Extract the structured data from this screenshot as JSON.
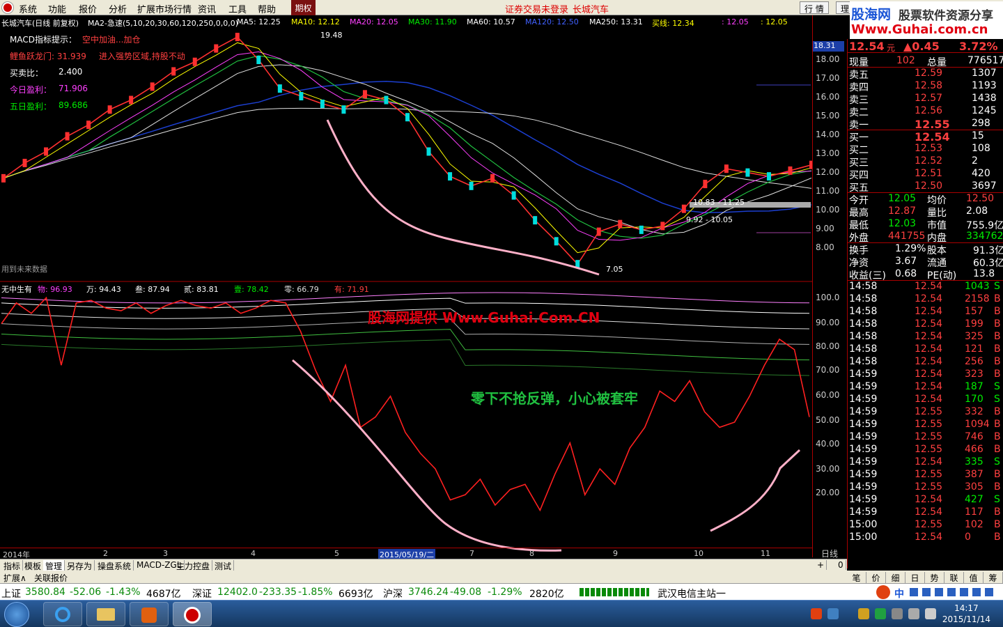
{
  "menu": {
    "items": [
      "系统",
      "功能",
      "报价",
      "分析",
      "扩展市场行情",
      "资讯",
      "工具",
      "帮助"
    ],
    "qiquan": "期权",
    "notice1": "证券交易未登录",
    "notice2": "长城汽车",
    "btn_hangqing": "行 情",
    "btn_li": "理"
  },
  "brand": {
    "line1": "股海网",
    "line2": "股票软件资源分享",
    "line3": "Www.Guhai.com.cn"
  },
  "indicator1": {
    "stock": "长城汽车(日线 前复权)",
    "formula": "MA2-急速(5,10,20,30,60,120,250,0,0,0)",
    "ma5": "MA5: 12.25",
    "ma10": "MA10: 12.12",
    "ma20": "MA20: 12.05",
    "ma30": "MA30: 11.90",
    "ma60": "MA60: 10.57",
    "ma120": "MA120: 12.50",
    "ma250": "MA250: 13.31",
    "buyline": "买线: 12.34",
    "v1": ": 12.05",
    "v2": ": 12.05"
  },
  "tips": {
    "macd": "MACD指标提示：",
    "macd_val": "空中加油...加仓",
    "liyu": "鲤鱼跃龙门: 31.939",
    "liyu_val": "进入强势区域,持股不动",
    "maimai": "买卖比：",
    "maimai_val": "2.400",
    "jinri": "今日盈利：",
    "jinri_val": "71.906",
    "wuri": "五日盈利：",
    "wuri_val": "89.686",
    "future": "用到未来数据"
  },
  "labels": {
    "high": "19.48",
    "low": "7.05",
    "r1": "10.83 - 11.25",
    "r2": "9.92 - 10.05"
  },
  "indicator2": {
    "name": "无中生有",
    "wu": "物: 96.93",
    "wan": "万: 94.43",
    "san": "叁: 87.94",
    "er": "贰: 83.81",
    "yi": "壹: 78.42",
    "ling": "零: 66.79",
    "you": "有: 71.91"
  },
  "watermark": "股海网提供 Www.Guhai.Com.CN",
  "warning": "零下不抢反弹，小心被套牢",
  "price_axis": [
    "18.00",
    "17.00",
    "16.00",
    "15.00",
    "14.00",
    "13.00",
    "12.00",
    "11.00",
    "10.00",
    "9.00",
    "8.00"
  ],
  "cur_price": "18.31",
  "osc_axis": [
    "100.0",
    "90.00",
    "80.00",
    "70.00",
    "60.00",
    "50.00",
    "40.00",
    "30.00",
    "20.00"
  ],
  "date_axis": [
    {
      "t": "2014年"
    },
    {
      "t": "2"
    },
    {
      "t": "3"
    },
    {
      "t": "4"
    },
    {
      "t": "5"
    },
    {
      "t": "2015/05/19/二"
    },
    {
      "t": "7"
    },
    {
      "t": "8"
    },
    {
      "t": "9"
    },
    {
      "t": "10"
    },
    {
      "t": "11"
    }
  ],
  "ribao": "日线",
  "tabs": [
    "指标",
    "模板",
    "管理",
    "另存为",
    "操盘系统",
    "MACD-ZGL",
    "主力控盘",
    "测试"
  ],
  "tabs2": [
    "扩展∧",
    "关联报价"
  ],
  "quote": {
    "price": "12.54",
    "unit": "元",
    "change": "▲0.45",
    "pct": "3.72%",
    "xianliang_l": "现量",
    "xianliang": "102",
    "zongliang_l": "总量",
    "zongliang": "776517",
    "asks": [
      {
        "l": "卖五",
        "p": "12.59",
        "v": "1307"
      },
      {
        "l": "卖四",
        "p": "12.58",
        "v": "1193"
      },
      {
        "l": "卖三",
        "p": "12.57",
        "v": "1438"
      },
      {
        "l": "卖二",
        "p": "12.56",
        "v": "1245"
      },
      {
        "l": "卖一",
        "p": "12.55",
        "v": "298"
      }
    ],
    "bids": [
      {
        "l": "买一",
        "p": "12.54",
        "v": "15"
      },
      {
        "l": "买二",
        "p": "12.53",
        "v": "108"
      },
      {
        "l": "买三",
        "p": "12.52",
        "v": "2"
      },
      {
        "l": "买四",
        "p": "12.51",
        "v": "420"
      },
      {
        "l": "买五",
        "p": "12.50",
        "v": "3697"
      }
    ],
    "stats": [
      {
        "a": "今开",
        "av": "12.05",
        "b": "均价",
        "bv": "12.50"
      },
      {
        "a": "最高",
        "av": "12.87",
        "b": "量比",
        "bv": "2.08"
      },
      {
        "a": "最低",
        "av": "12.03",
        "b": "市值",
        "bv": "755.9亿"
      },
      {
        "a": "外盘",
        "av": "441755",
        "b": "内盘",
        "bv": "334762"
      }
    ],
    "stats2": [
      {
        "a": "换手",
        "av": "1.29%",
        "b": "股本",
        "bv": "91.3亿"
      },
      {
        "a": "净资",
        "av": "3.67",
        "b": "流通",
        "bv": "60.3亿"
      },
      {
        "a": "收益(三)",
        "av": "0.68",
        "b": "PE(动)",
        "bv": "13.8"
      }
    ],
    "ticks": [
      {
        "t": "14:58",
        "p": "12.54",
        "v": "1043",
        "s": "S"
      },
      {
        "t": "14:58",
        "p": "12.54",
        "v": "2158",
        "s": "B"
      },
      {
        "t": "14:58",
        "p": "12.54",
        "v": "157",
        "s": "B"
      },
      {
        "t": "14:58",
        "p": "12.54",
        "v": "199",
        "s": "B"
      },
      {
        "t": "14:58",
        "p": "12.54",
        "v": "325",
        "s": "B"
      },
      {
        "t": "14:58",
        "p": "12.54",
        "v": "121",
        "s": "B"
      },
      {
        "t": "14:58",
        "p": "12.54",
        "v": "256",
        "s": "B"
      },
      {
        "t": "14:59",
        "p": "12.54",
        "v": "323",
        "s": "B"
      },
      {
        "t": "14:59",
        "p": "12.54",
        "v": "187",
        "s": "S"
      },
      {
        "t": "14:59",
        "p": "12.54",
        "v": "170",
        "s": "S"
      },
      {
        "t": "14:59",
        "p": "12.55",
        "v": "332",
        "s": "B"
      },
      {
        "t": "14:59",
        "p": "12.55",
        "v": "1094",
        "s": "B"
      },
      {
        "t": "14:59",
        "p": "12.55",
        "v": "746",
        "s": "B"
      },
      {
        "t": "14:59",
        "p": "12.55",
        "v": "466",
        "s": "B"
      },
      {
        "t": "14:59",
        "p": "12.54",
        "v": "335",
        "s": "S"
      },
      {
        "t": "14:59",
        "p": "12.55",
        "v": "387",
        "s": "B"
      },
      {
        "t": "14:59",
        "p": "12.55",
        "v": "305",
        "s": "B"
      },
      {
        "t": "14:59",
        "p": "12.54",
        "v": "427",
        "s": "S"
      },
      {
        "t": "14:59",
        "p": "12.54",
        "v": "117",
        "s": "B"
      },
      {
        "t": "15:00",
        "p": "12.55",
        "v": "102",
        "s": "B"
      },
      {
        "t": "15:00",
        "p": "12.54",
        "v": "0",
        "s": "B"
      }
    ]
  },
  "rtabs": [
    "笔",
    "价",
    "细",
    "日",
    "势",
    "联",
    "值",
    "筹"
  ],
  "status": {
    "sh_l": "上证",
    "sh": "3580.84",
    "sh_c": "-52.06",
    "sh_p": "-1.43%",
    "sh_v": "4687亿",
    "sz_l": "深证",
    "sz": "12402.0",
    "sz_c": "-233.35",
    "sz_p": "-1.85%",
    "sz_v": "6693亿",
    "hs_l": "沪深",
    "hs": "3746.24",
    "hs_c": "-49.08",
    "hs_p": "-1.29%",
    "hs_v": "2820亿",
    "station": "武汉电信主站一"
  },
  "taskbar": {
    "time": "14:17",
    "date": "2015/11/14"
  },
  "chart_data": {
    "type": "line",
    "price_range": [
      7.05,
      19.48
    ],
    "price_labels": {
      "high": 19.48,
      "low": 7.05
    },
    "main_price": [
      11.8,
      12.6,
      13.2,
      14.0,
      14.6,
      15.4,
      15.9,
      16.6,
      17.4,
      17.9,
      18.6,
      19.2,
      18.0,
      16.5,
      16.1,
      15.7,
      15.4,
      16.2,
      15.9,
      15.0,
      13.2,
      11.9,
      11.4,
      11.8,
      10.9,
      9.6,
      8.5,
      7.3,
      9.0,
      9.4,
      9.1,
      9.3,
      10.2,
      11.5,
      12.3,
      12.1,
      11.9,
      12.2,
      12.5
    ],
    "oscillator": [
      88,
      96,
      92,
      98,
      72,
      96,
      97,
      94,
      93,
      96,
      92,
      95,
      97,
      95,
      94,
      96,
      92,
      94,
      97,
      96,
      85,
      70,
      58,
      72,
      48,
      52,
      60,
      46,
      38,
      32,
      20,
      22,
      28,
      18,
      24,
      26,
      16,
      30,
      42,
      22,
      32,
      26,
      40,
      48,
      62,
      58,
      66,
      54,
      48,
      50,
      60,
      72,
      82,
      78,
      52
    ]
  }
}
